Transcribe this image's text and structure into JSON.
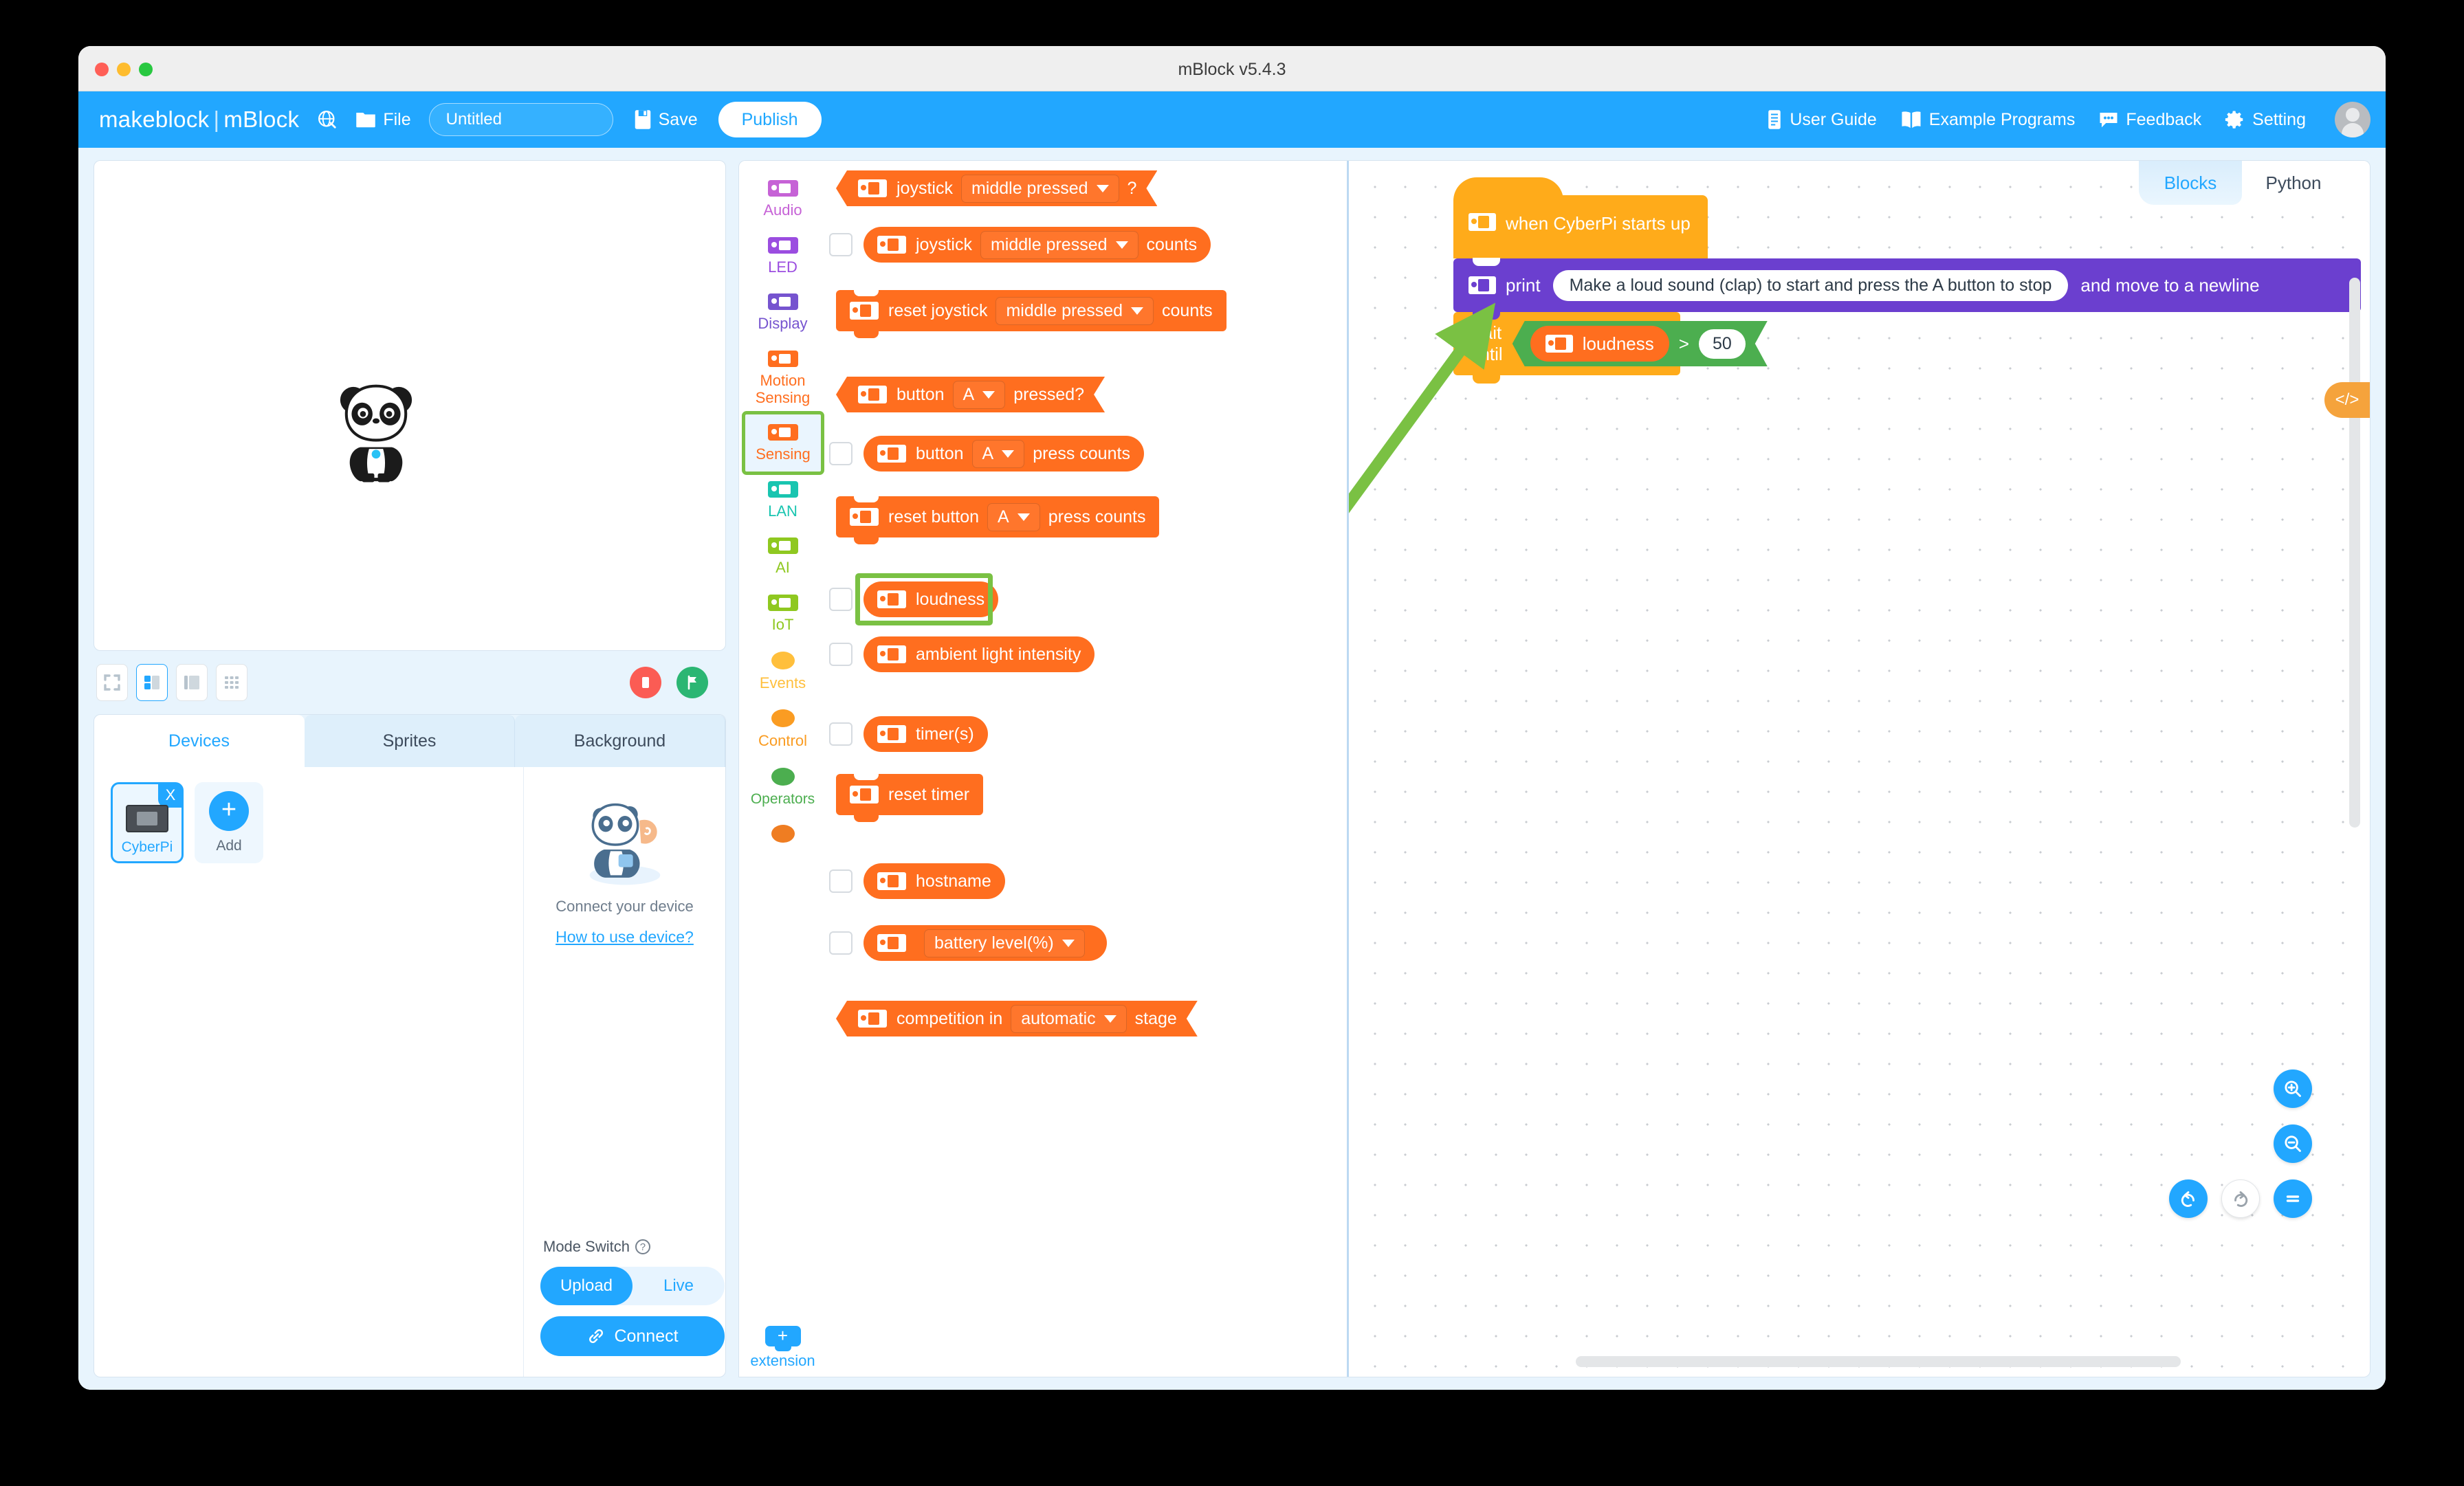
{
  "window": {
    "title": "mBlock v5.4.3"
  },
  "menubar": {
    "brand_left": "makeblock",
    "brand_sep": "|",
    "brand_right": "mBlock",
    "globe_icon": "globe-icon",
    "file_icon": "file-icon",
    "file_label": "File",
    "project_name_value": "Untitled",
    "project_name_placeholder": "Untitled",
    "save_icon": "save-icon",
    "save_label": "Save",
    "publish_label": "Publish",
    "right_items": [
      {
        "icon": "book-icon",
        "label": "User Guide"
      },
      {
        "icon": "open-book-icon",
        "label": "Example Programs"
      },
      {
        "icon": "chat-icon",
        "label": "Feedback"
      },
      {
        "icon": "gear-icon",
        "label": "Setting"
      }
    ],
    "avatar": "user-avatar"
  },
  "stage": {
    "sprite": "panda-sprite",
    "layout_buttons": [
      {
        "name": "fullscreen-layout",
        "active": false
      },
      {
        "name": "small-stage-layout",
        "active": true
      },
      {
        "name": "large-stage-layout",
        "active": false
      },
      {
        "name": "grid-layout",
        "active": false
      }
    ],
    "stop_button": "stop-button",
    "go_button": "green-flag-button"
  },
  "device_panel": {
    "tabs": [
      {
        "label": "Devices",
        "active": true
      },
      {
        "label": "Sprites",
        "active": false
      },
      {
        "label": "Background",
        "active": false
      }
    ],
    "device": {
      "name": "CyberPi",
      "close_label": "X"
    },
    "add": {
      "plus": "+",
      "label": "Add"
    },
    "connect_text": "Connect your device",
    "how_to_link": "How to use device?",
    "mode_switch_label": "Mode Switch",
    "mode_help_icon": "?",
    "modes": [
      {
        "label": "Upload",
        "active": true
      },
      {
        "label": "Live",
        "active": false
      }
    ],
    "connect_button": "Connect",
    "connect_icon": "link-icon"
  },
  "categories": [
    {
      "label": "Audio",
      "color": "#c662d6",
      "shape": "chip",
      "selected": false
    },
    {
      "label": "LED",
      "color": "#9b4de0",
      "shape": "chip",
      "selected": false
    },
    {
      "label": "Display",
      "color": "#7654cf",
      "shape": "chip",
      "selected": false
    },
    {
      "label": "Motion\nSensing",
      "color": "#ff6e1f",
      "shape": "chip",
      "selected": false
    },
    {
      "label": "Sensing",
      "color": "#ff6e1f",
      "shape": "chip",
      "selected": true
    },
    {
      "label": "LAN",
      "color": "#19c5b0",
      "shape": "chip",
      "selected": false
    },
    {
      "label": "AI",
      "color": "#8fc820",
      "shape": "chip",
      "selected": false
    },
    {
      "label": "IoT",
      "color": "#8fc820",
      "shape": "chip",
      "selected": false
    },
    {
      "label": "Events",
      "color": "#ffbf3c",
      "shape": "dot",
      "selected": false
    },
    {
      "label": "Control",
      "color": "#fa9c22",
      "shape": "dot",
      "selected": false
    },
    {
      "label": "Operators",
      "color": "#4cae4f",
      "shape": "dot",
      "selected": false
    },
    {
      "label": "",
      "color": "#ef7d22",
      "shape": "dot",
      "selected": false
    }
  ],
  "extension": {
    "plus": "+",
    "label": "extension"
  },
  "palette": {
    "highlight_note": "loudness block is highlighted with a green box",
    "blocks": [
      {
        "id": "joystick-pressed",
        "kind": "bool",
        "checkbox": false,
        "parts": [
          {
            "t": "text",
            "v": "joystick"
          },
          {
            "t": "drop",
            "v": "middle pressed"
          },
          {
            "t": "text",
            "v": "?"
          }
        ]
      },
      {
        "id": "joystick-counts",
        "kind": "round",
        "checkbox": true,
        "parts": [
          {
            "t": "text",
            "v": "joystick"
          },
          {
            "t": "drop",
            "v": "middle pressed"
          },
          {
            "t": "text",
            "v": "counts"
          }
        ]
      },
      {
        "id": "reset-joystick",
        "kind": "stack",
        "checkbox": false,
        "parts": [
          {
            "t": "text",
            "v": "reset joystick"
          },
          {
            "t": "drop",
            "v": "middle pressed"
          },
          {
            "t": "text",
            "v": "counts"
          }
        ]
      },
      {
        "id": "button-pressed",
        "kind": "bool",
        "checkbox": false,
        "parts": [
          {
            "t": "text",
            "v": "button"
          },
          {
            "t": "drop",
            "v": "A"
          },
          {
            "t": "text",
            "v": "pressed?"
          }
        ]
      },
      {
        "id": "button-press-counts",
        "kind": "round",
        "checkbox": true,
        "parts": [
          {
            "t": "text",
            "v": "button"
          },
          {
            "t": "drop",
            "v": "A"
          },
          {
            "t": "text",
            "v": "press counts"
          }
        ]
      },
      {
        "id": "reset-button-counts",
        "kind": "stack",
        "checkbox": false,
        "parts": [
          {
            "t": "text",
            "v": "reset button"
          },
          {
            "t": "drop",
            "v": "A"
          },
          {
            "t": "text",
            "v": "press counts"
          }
        ]
      },
      {
        "id": "loudness",
        "kind": "round",
        "checkbox": true,
        "parts": [
          {
            "t": "text",
            "v": "loudness"
          }
        ]
      },
      {
        "id": "ambient-light",
        "kind": "round",
        "checkbox": true,
        "parts": [
          {
            "t": "text",
            "v": "ambient light intensity"
          }
        ]
      },
      {
        "id": "timer",
        "kind": "round",
        "checkbox": true,
        "parts": [
          {
            "t": "text",
            "v": "timer(s)"
          }
        ]
      },
      {
        "id": "reset-timer",
        "kind": "stack",
        "checkbox": false,
        "parts": [
          {
            "t": "text",
            "v": "reset timer"
          }
        ]
      },
      {
        "id": "hostname",
        "kind": "round",
        "checkbox": true,
        "parts": [
          {
            "t": "text",
            "v": "hostname"
          }
        ]
      },
      {
        "id": "battery-level",
        "kind": "round",
        "checkbox": true,
        "parts": [
          {
            "t": "drop",
            "v": "battery level(%)"
          }
        ]
      },
      {
        "id": "competition-stage",
        "kind": "bool",
        "checkbox": false,
        "parts": [
          {
            "t": "text",
            "v": "competition in"
          },
          {
            "t": "drop",
            "v": "automatic"
          },
          {
            "t": "text",
            "v": "stage"
          }
        ]
      }
    ]
  },
  "workspace": {
    "code_tabs": [
      {
        "label": "Blocks",
        "active": true
      },
      {
        "label": "Python",
        "active": false
      }
    ],
    "code_toggle_icon": "</>",
    "script": {
      "hat_label": "when CyberPi starts up",
      "print_label": "print",
      "print_value": "Make a loud sound (clap) to start and press the A button to stop",
      "print_suffix": "and move to a newline",
      "wait_label": "wait until",
      "cond_left": "loudness",
      "cond_op": ">",
      "cond_right": "50"
    },
    "zoom_in_icon": "zoom-in-icon",
    "zoom_out_icon": "zoom-out-icon",
    "zoom_reset_icon": "zoom-reset-icon",
    "undo_icon": "undo-icon",
    "redo_icon": "redo-icon"
  },
  "colors": {
    "accent": "#22a7ff",
    "sensing_orange": "#ff6e1f",
    "events_yellow": "#ffab1a",
    "display_purple": "#6b3fcf",
    "operators_green": "#4cae4f",
    "annotation_green": "#7ac143"
  }
}
